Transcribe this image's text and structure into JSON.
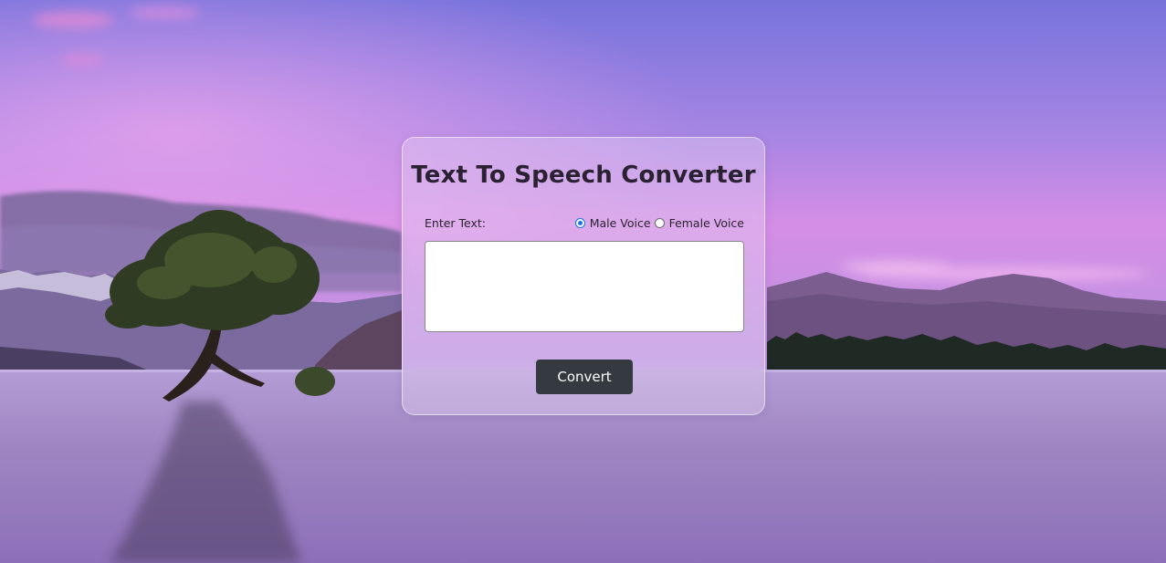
{
  "background": {
    "description_icon": "lake-landscape-image",
    "sky_top": "#7a74d8",
    "sky_mid": "#c88ae6",
    "water": "#9f86c0"
  },
  "card": {
    "title": "Text To Speech Converter",
    "enter_text_label": "Enter Text:",
    "voices": [
      {
        "label": "Male Voice",
        "checked": true
      },
      {
        "label": "Female Voice",
        "checked": false
      }
    ],
    "text_value": "",
    "convert_label": "Convert"
  },
  "colors": {
    "button_bg": "#343a40",
    "radio_accent": "#1a73e8"
  }
}
